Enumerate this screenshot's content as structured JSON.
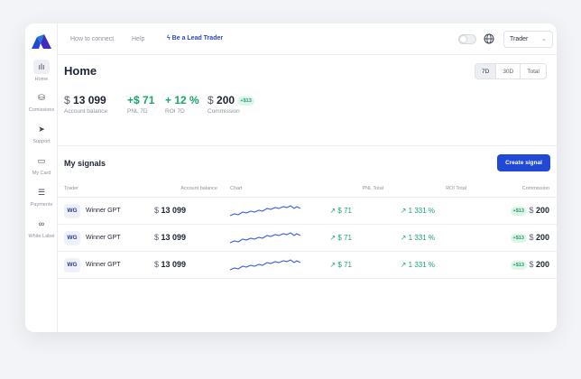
{
  "sidebar": {
    "items": [
      {
        "label": "Home",
        "icon": "bar-chart-icon",
        "glyph": "ılı"
      },
      {
        "label": "Comissions",
        "icon": "coins-icon",
        "glyph": "⛁"
      },
      {
        "label": "Support",
        "icon": "paper-plane-icon",
        "glyph": "➤"
      },
      {
        "label": "My Card",
        "icon": "card-icon",
        "glyph": "▭"
      },
      {
        "label": "Payments",
        "icon": "list-icon",
        "glyph": "☰"
      },
      {
        "label": "White Label",
        "icon": "link-icon",
        "glyph": "∞"
      }
    ]
  },
  "topbar": {
    "how_to_connect": "How to connect",
    "help": "Help",
    "lead_trader": "Be a Lead Trader",
    "role_select": "Trader"
  },
  "page": {
    "title": "Home",
    "periods": [
      "7D",
      "30D",
      "Total"
    ],
    "selected_period": "7D"
  },
  "stats": {
    "balance": {
      "currency": "$",
      "value": "13 099",
      "label": "Account balance"
    },
    "pnl": {
      "value": "+$ 71",
      "label": "PNL 7D"
    },
    "roi": {
      "value": "+ 12 %",
      "label": "ROI 7D"
    },
    "commission": {
      "currency": "$",
      "value": "200",
      "pill": "+$13",
      "label": "Commission"
    }
  },
  "signals": {
    "title": "My signals",
    "create_label": "Create signal",
    "headers": {
      "trader": "Trader",
      "balance": "Account balance",
      "chart": "Chart",
      "pnl": "PNL Total",
      "roi": "ROI Total",
      "commission": "Commission"
    },
    "rows": [
      {
        "initials": "WG",
        "name": "Winner GPT",
        "currency": "$",
        "balance": "13 099",
        "pnl": "↗ $ 71",
        "roi": "↗ 1 331 %",
        "comm_pill": "+$13",
        "comm_currency": "$",
        "commission": "200"
      },
      {
        "initials": "WG",
        "name": "Winner GPT",
        "currency": "$",
        "balance": "13 099",
        "pnl": "↗ $ 71",
        "roi": "↗ 1 331 %",
        "comm_pill": "+$13",
        "comm_currency": "$",
        "commission": "200"
      },
      {
        "initials": "WG",
        "name": "Winner GPT",
        "currency": "$",
        "balance": "13 099",
        "pnl": "↗ $ 71",
        "roi": "↗ 1 331 %",
        "comm_pill": "+$13",
        "comm_currency": "$",
        "commission": "200"
      }
    ]
  },
  "colors": {
    "accent": "#2049d6",
    "positive": "#1aa56b",
    "spark": "#3b5ee6"
  }
}
